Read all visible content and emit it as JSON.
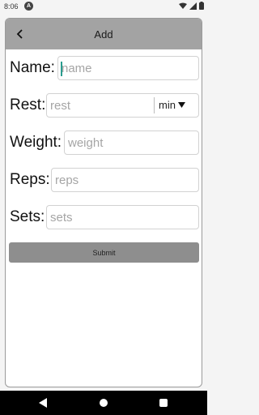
{
  "status_bar": {
    "time": "8:06",
    "notification_letter": "A"
  },
  "app_bar": {
    "title": "Add",
    "back_icon": "chevron-left-icon"
  },
  "form": {
    "name": {
      "label": "Name:",
      "placeholder": "name",
      "value": ""
    },
    "rest": {
      "label": "Rest:",
      "placeholder": "rest",
      "value": "",
      "unit": "min",
      "unit_icon": "caret-down-icon"
    },
    "weight": {
      "label": "Weight:",
      "placeholder": "weight",
      "value": ""
    },
    "reps": {
      "label": "Reps:",
      "placeholder": "reps",
      "value": ""
    },
    "sets": {
      "label": "Sets:",
      "placeholder": "sets",
      "value": ""
    },
    "submit_label": "Submit"
  },
  "colors": {
    "app_bar": "#a3a3a3",
    "submit_button": "#8e8e8e",
    "cursor": "#2a9d8f",
    "nav_bar": "#000000"
  }
}
